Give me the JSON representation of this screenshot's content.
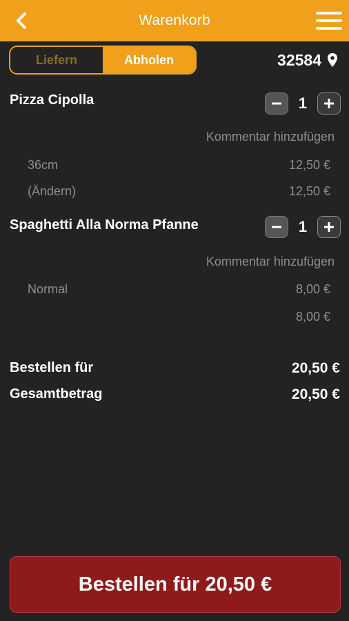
{
  "header": {
    "title": "Warenkorb",
    "back_icon": "chevron-left-icon",
    "menu_icon": "hamburger-menu-icon"
  },
  "mode_toggle": {
    "options": [
      "Liefern",
      "Abholen"
    ],
    "selected": "Abholen"
  },
  "location": {
    "zip": "32584",
    "icon": "map-pin-icon"
  },
  "cart": {
    "items": [
      {
        "name": "Pizza Cipolla",
        "quantity": "1",
        "comment_label": "Kommentar hinzufügen",
        "lines": [
          {
            "label": "36cm",
            "price": "12,50 €"
          },
          {
            "label": "(Ändern)",
            "price": "12,50 €"
          }
        ]
      },
      {
        "name": "Spaghetti Alla Norma Pfanne",
        "quantity": "1",
        "comment_label": "Kommentar hinzufügen",
        "lines": [
          {
            "label": "Normal",
            "price": "8,00 €"
          },
          {
            "label": "",
            "price": "8,00 €"
          }
        ]
      }
    ]
  },
  "summary": {
    "order_for_label": "Bestellen für",
    "order_for_value": "20,50 €",
    "total_label": "Gesamtbetrag",
    "total_value": "20,50 €"
  },
  "order_button": {
    "label": "Bestellen für 20,50 €"
  },
  "colors": {
    "accent": "#f0a01a",
    "background": "#232323",
    "order_button": "#8e1a1a"
  }
}
